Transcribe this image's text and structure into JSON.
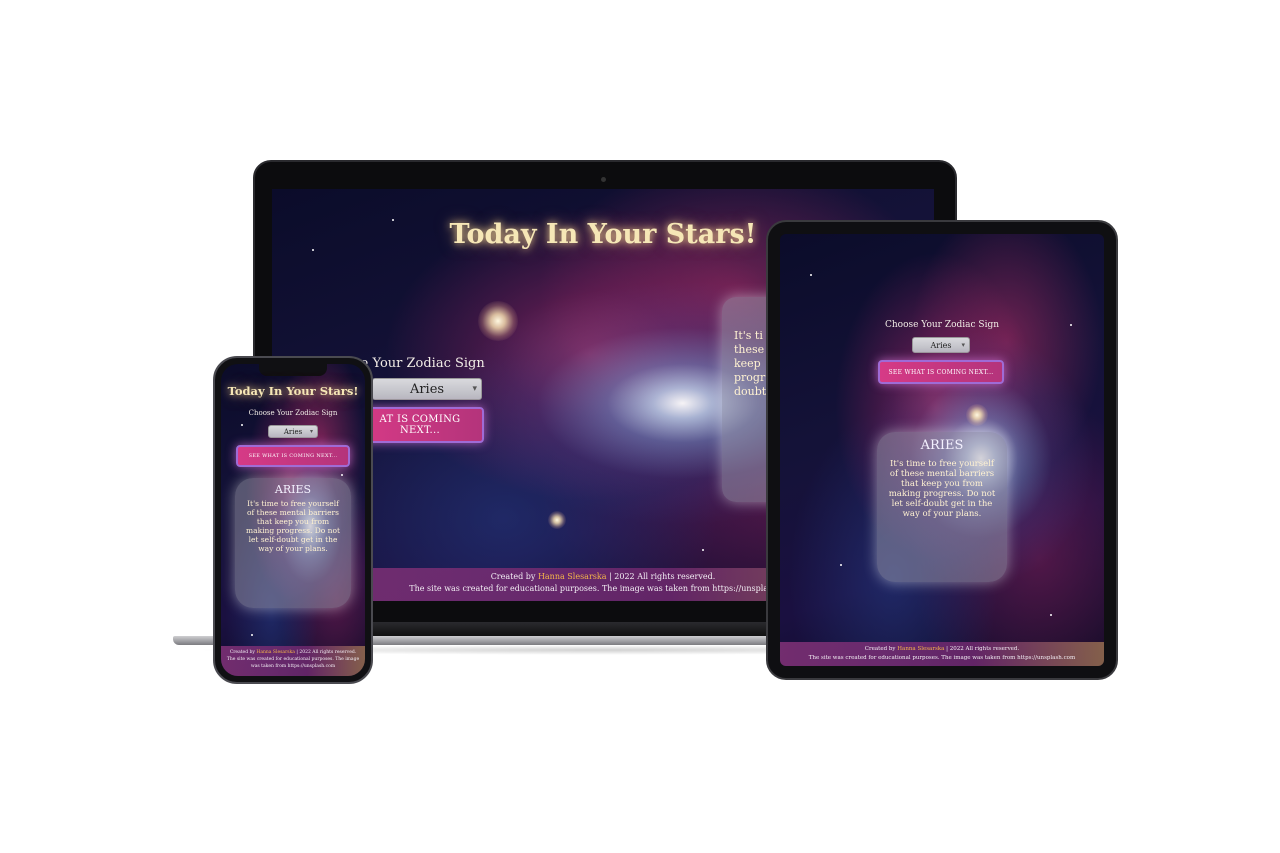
{
  "site": {
    "title": "Today In Your Stars!",
    "choose_label": "Choose Your Zodiac Sign",
    "select_value": "Aries",
    "cta_label": "SEE WHAT IS COMING NEXT...",
    "card_sign": "ARIES",
    "card_text": "It's time to free yourself of these mental barriers that keep you from making progress. Do not let self-doubt get in the way of your plans.",
    "footer_created_prefix": "Created by",
    "footer_author": "Hanna Slesarska",
    "footer_rights": "| 2022 All rights reserved.",
    "footer_note": "The site was created for educational purposes. The image was taken from https://unsplash.com"
  },
  "laptop": {
    "choose_label": "se Your Zodiac Sign",
    "cta_label": "AT IS COMING NEXT...",
    "card_text_partial": "It's ti these keep progr doubt"
  },
  "colors": {
    "title_glow": "#f6e7b6",
    "cta": "#d63a86",
    "author": "#f3b54a",
    "frame": "#111111"
  }
}
